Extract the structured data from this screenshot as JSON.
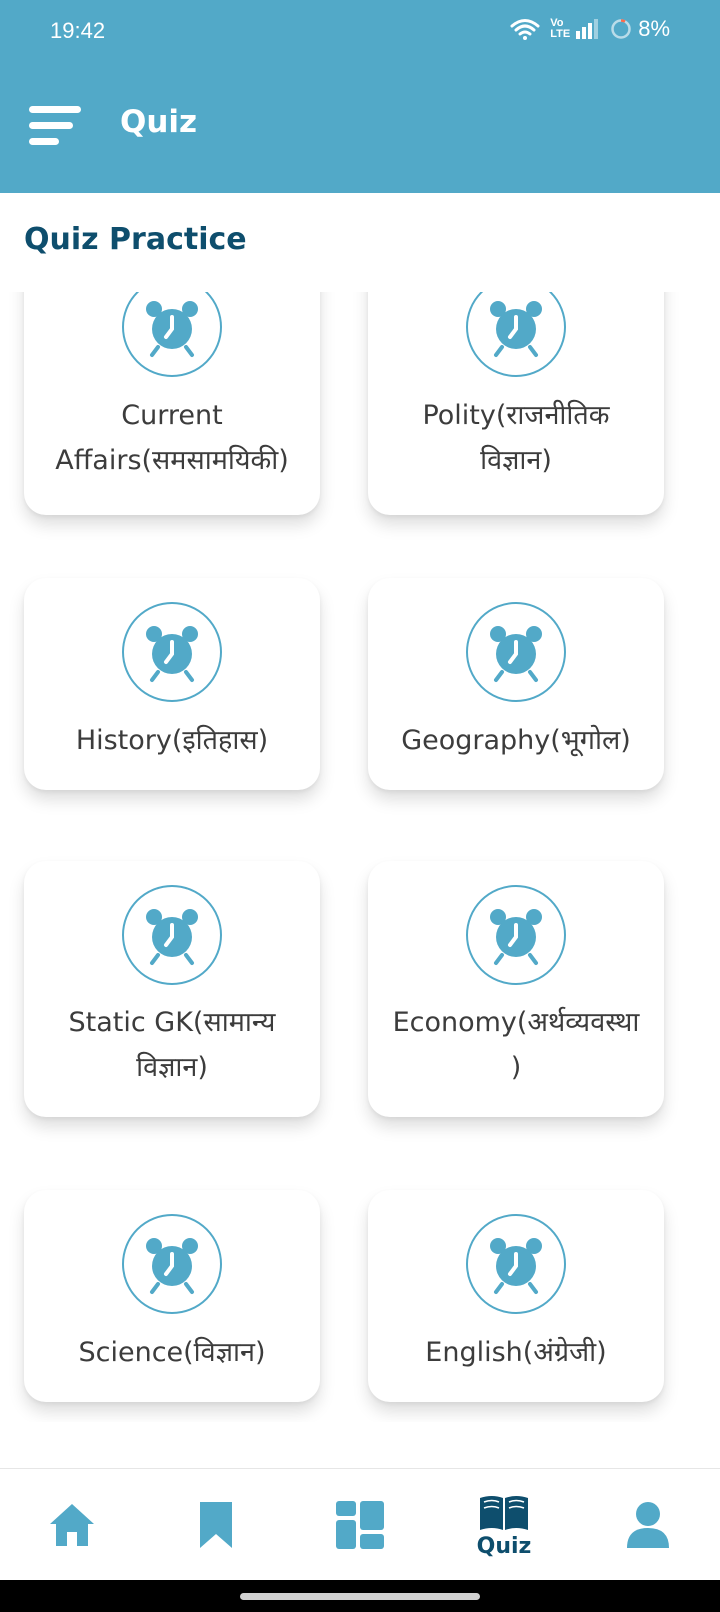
{
  "status": {
    "time": "19:42",
    "network_label": "Vo LTE",
    "battery": "8%"
  },
  "header": {
    "title": "Quiz",
    "background_color": "#52a9c8"
  },
  "section": {
    "title": "Quiz Practice"
  },
  "cards": [
    {
      "label_line1": "Current",
      "label_line2": "Affairs(समसामयिकी)",
      "icon": "alarm-clock-icon"
    },
    {
      "label_line1": "Polity(राजनीतिक",
      "label_line2": "विज्ञान)",
      "icon": "alarm-clock-icon"
    },
    {
      "label_line1": "History(इतिहास)",
      "label_line2": "",
      "icon": "alarm-clock-icon"
    },
    {
      "label_line1": "Geography(भूगोल)",
      "label_line2": "",
      "icon": "alarm-clock-icon"
    },
    {
      "label_line1": "Static GK(सामान्य",
      "label_line2": "विज्ञान)",
      "icon": "alarm-clock-icon"
    },
    {
      "label_line1": "Economy(अर्थव्यवस्था",
      "label_line2": ")",
      "icon": "alarm-clock-icon"
    },
    {
      "label_line1": "Science(विज्ञान)",
      "label_line2": "",
      "icon": "alarm-clock-icon"
    },
    {
      "label_line1": "English(अंग्रेजी)",
      "label_line2": "",
      "icon": "alarm-clock-icon"
    }
  ],
  "bottom_nav": {
    "items": [
      {
        "name": "home",
        "icon": "home-icon",
        "label": ""
      },
      {
        "name": "bookmarks",
        "icon": "bookmark-icon",
        "label": ""
      },
      {
        "name": "dashboard",
        "icon": "grid-icon",
        "label": ""
      },
      {
        "name": "quiz",
        "icon": "book-icon",
        "label": "Quiz",
        "active": true
      },
      {
        "name": "profile",
        "icon": "user-icon",
        "label": ""
      }
    ]
  },
  "colors": {
    "accent": "#52a9c8",
    "dark_accent": "#0e4e6d",
    "text": "#3c3c3c"
  }
}
